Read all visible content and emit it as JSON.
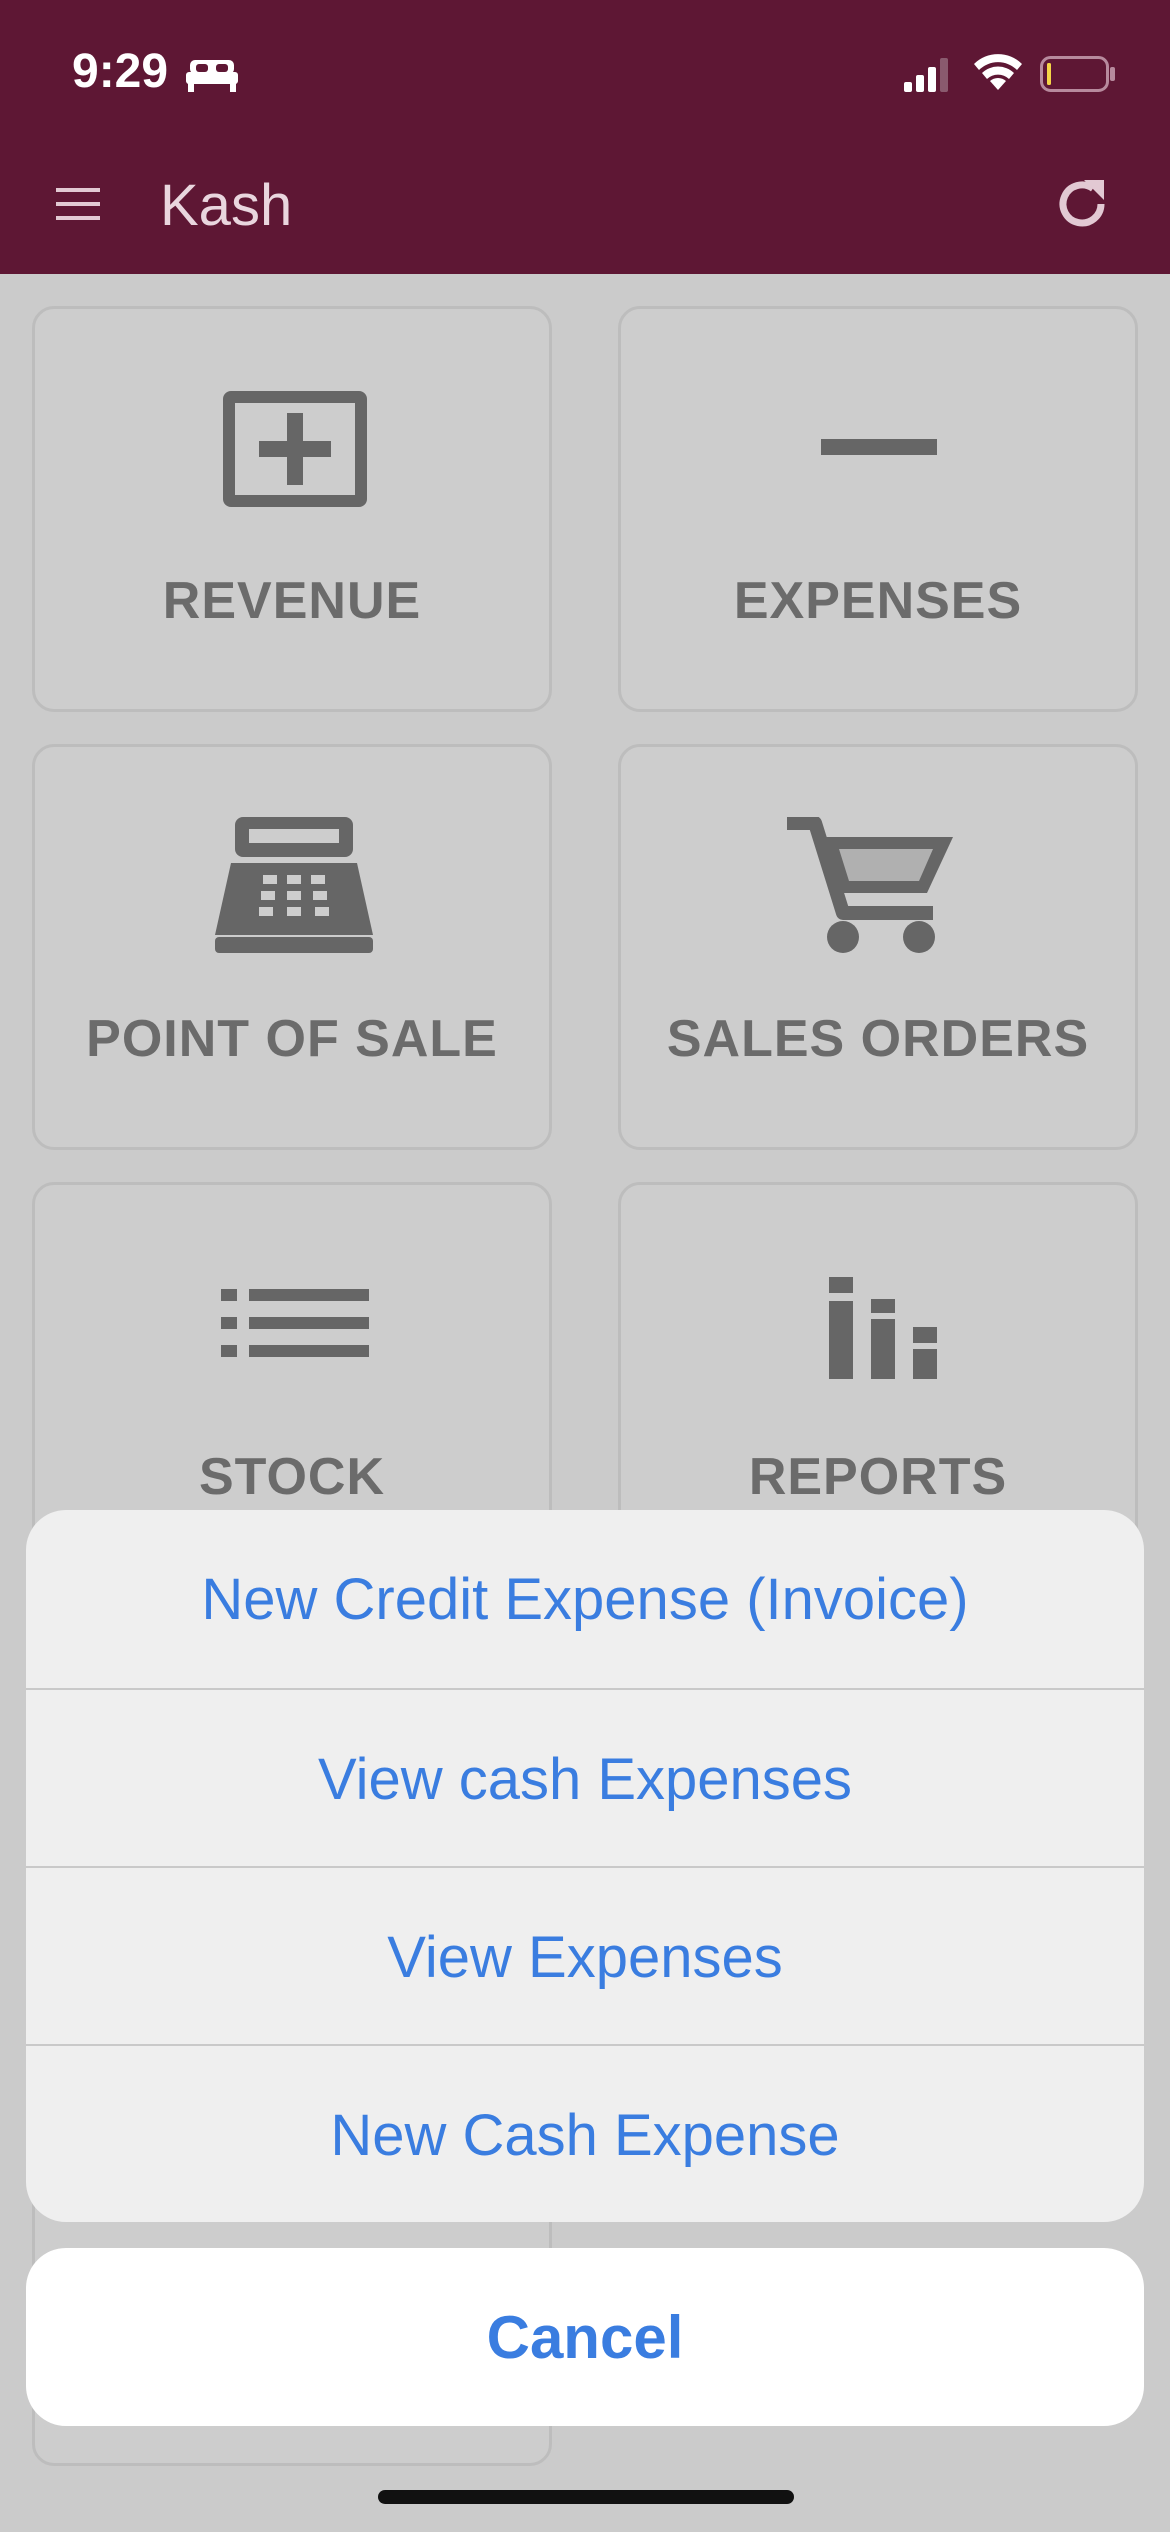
{
  "status_bar": {
    "time": "9:29",
    "icons": [
      "bed-icon",
      "signal-icon",
      "wifi-icon",
      "battery-icon"
    ]
  },
  "app_bar": {
    "title": "Kash",
    "left_icon": "menu-icon",
    "right_icon": "refresh-icon",
    "background": "#5e1734"
  },
  "tiles": [
    {
      "label": "REVENUE",
      "icon": "add-box-icon"
    },
    {
      "label": "EXPENSES",
      "icon": "minus-icon"
    },
    {
      "label": "POINT OF SALE",
      "icon": "cash-register-icon"
    },
    {
      "label": "SALES ORDERS",
      "icon": "cart-icon"
    },
    {
      "label": "STOCK",
      "icon": "list-icon"
    },
    {
      "label": "REPORTS",
      "icon": "bar-chart-icon"
    }
  ],
  "action_sheet": {
    "options": [
      "New Credit Expense (Invoice)",
      "View cash Expenses",
      "View Expenses",
      "New Cash Expense"
    ],
    "cancel_label": "Cancel",
    "accent": "#3a7de0"
  }
}
